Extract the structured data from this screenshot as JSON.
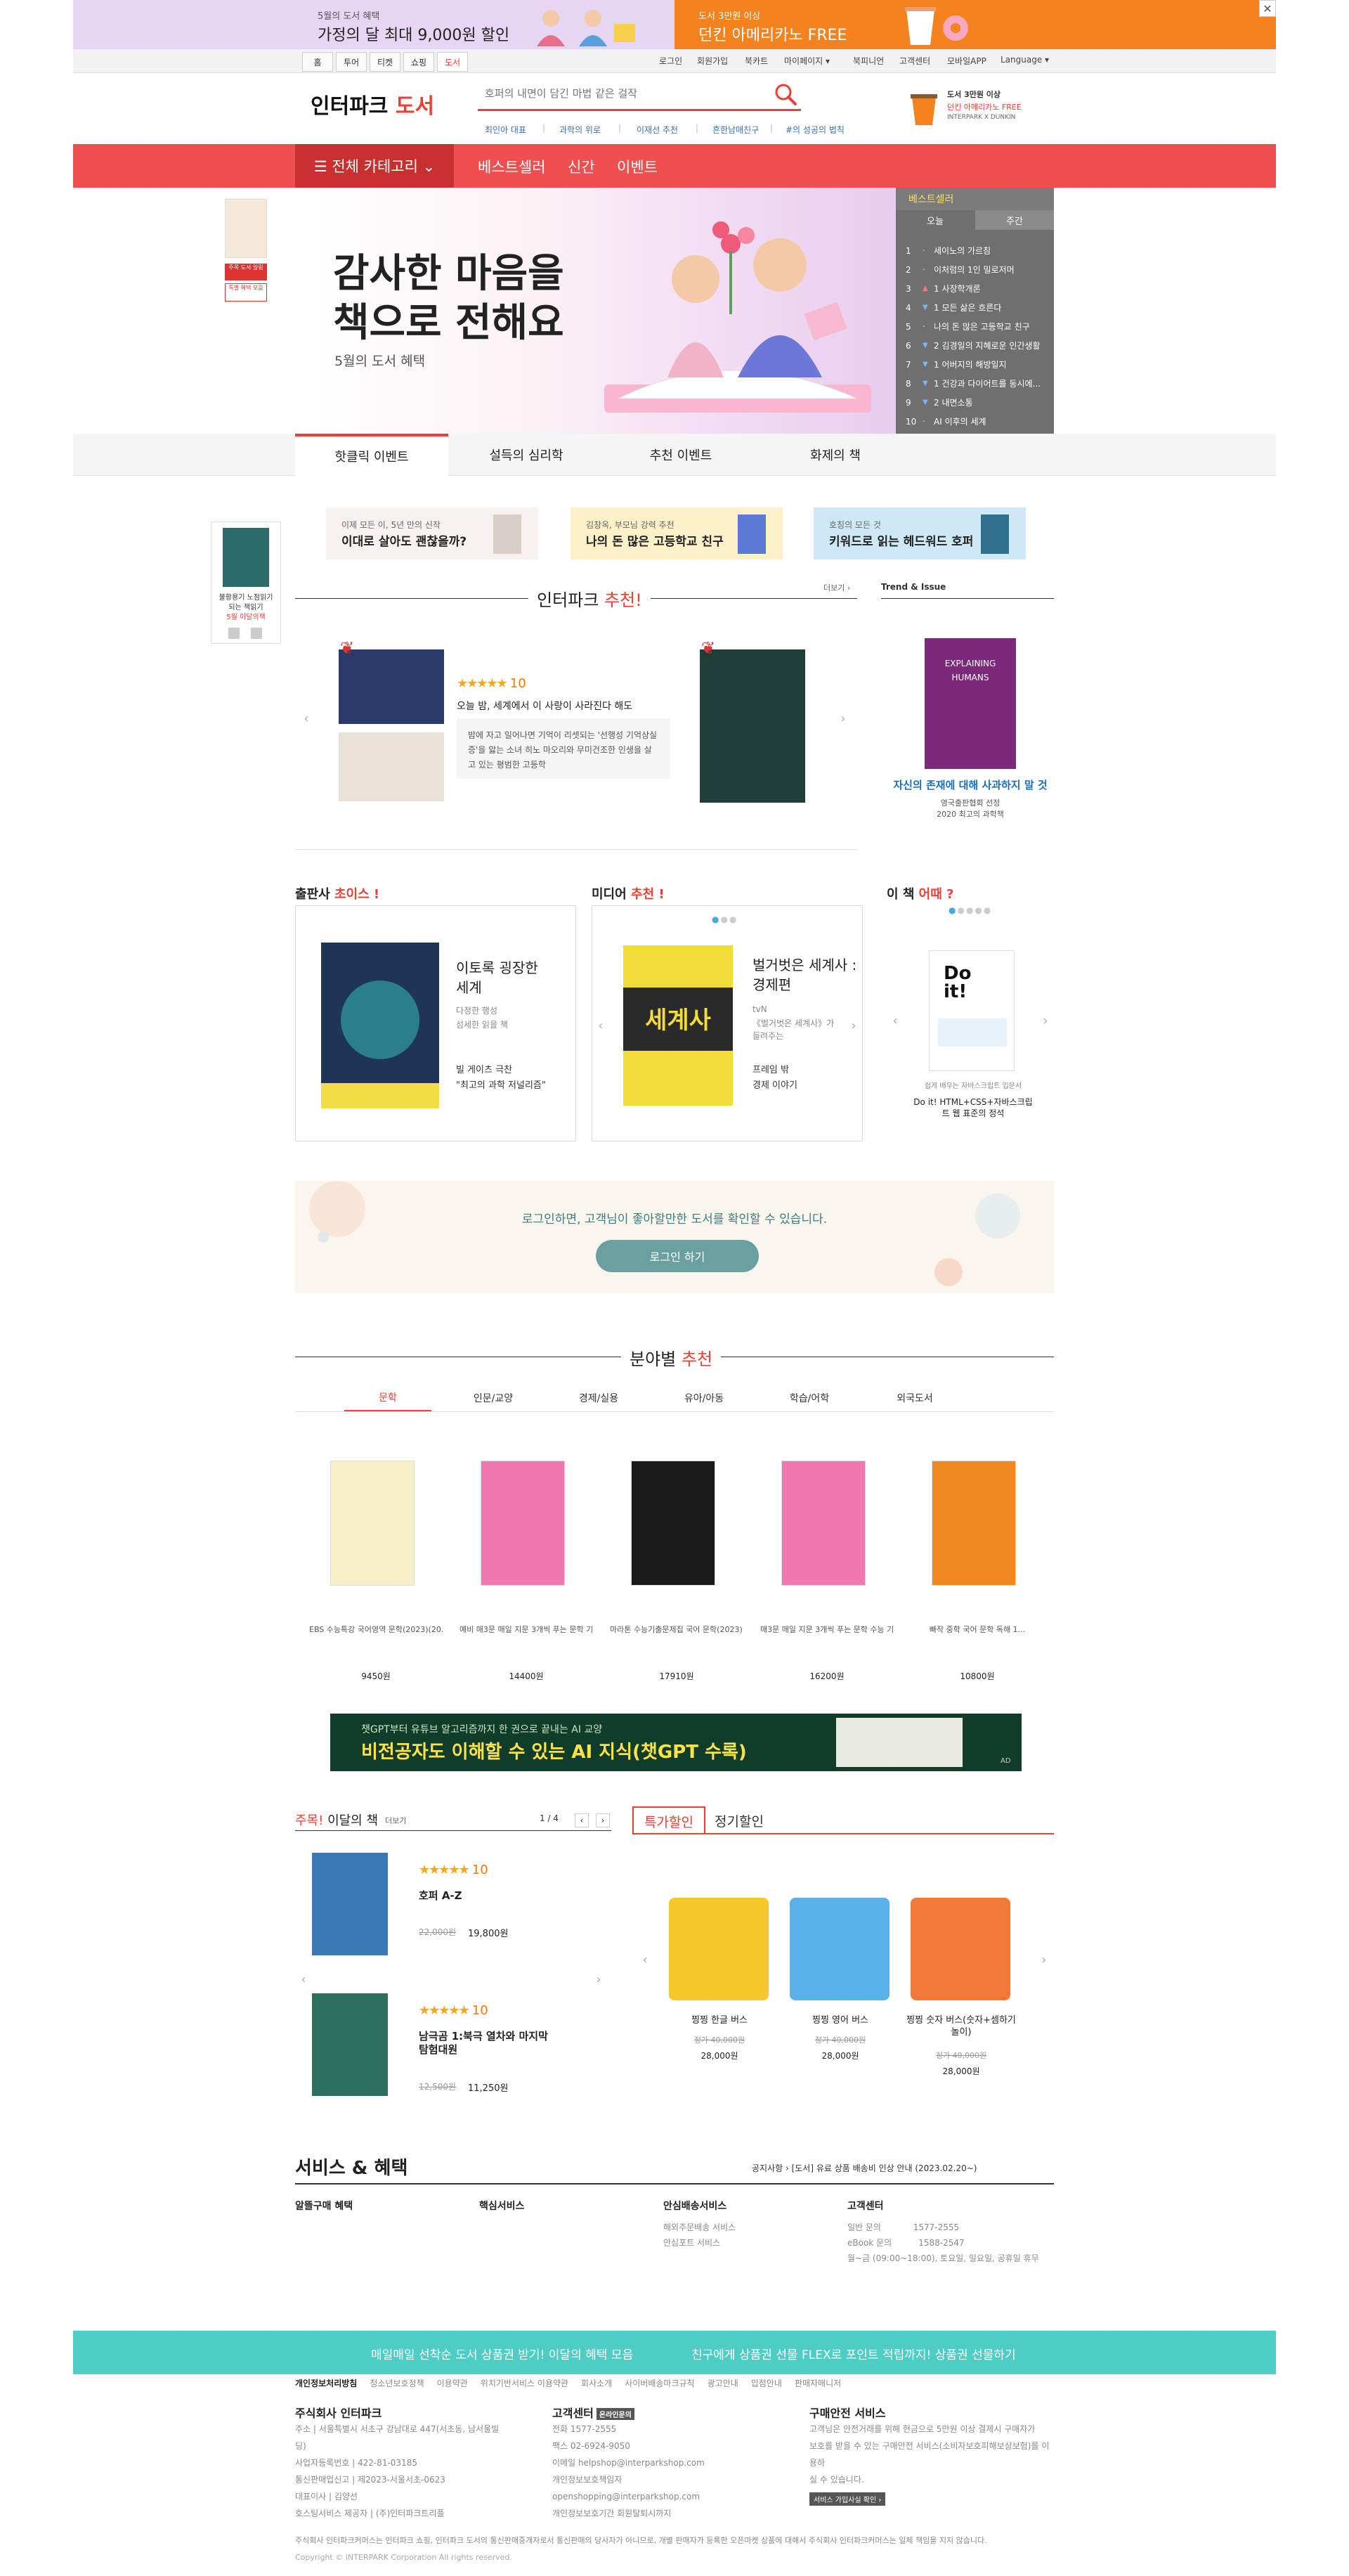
{
  "top_banner": {
    "left_small": "5월의 도서 혜택",
    "left_big": "가정의 달 최대 9,000원 할인",
    "right_small": "도서 3만원 이상",
    "right_big": "던킨 아메리카노 FREE",
    "close": "✕"
  },
  "gnb": {
    "tabs": [
      "홈",
      "투어",
      "티켓",
      "쇼핑",
      "도서"
    ],
    "active_tab": "도서",
    "util": [
      "로그인",
      "회원가입",
      "북카트",
      "마이페이지 ▾",
      "북피니언",
      "고객센터",
      "모바일APP",
      "Language ▾"
    ]
  },
  "header": {
    "logo_main": "인터파크",
    "logo_sub": "도서",
    "search_placeholder": "호퍼의 내면이 담긴 마법 같은 걸작",
    "keywords": [
      "최인아 대표",
      "과학의 위로",
      "이재선 추천",
      "흔한남매친구",
      "#의 성공의 법칙"
    ],
    "ad_line1": "도서 3만원 이상",
    "ad_line2": "던킨 아메리카노 FREE",
    "ad_line3": "INTERPARK X DUNKIN"
  },
  "nav": {
    "all_category": "☰ 전체 카테고리 ⌄",
    "links": [
      "베스트셀러",
      "신간",
      "이벤트"
    ]
  },
  "hero": {
    "title_line1": "감사한 마음을",
    "title_line2": "책으로 전해요",
    "subtitle": "5월의 도서 혜택"
  },
  "bestseller": {
    "title": "베스트셀러",
    "tabs": [
      "오늘",
      "주간"
    ],
    "items": [
      {
        "rank": "1",
        "change": "-",
        "title": "세이노의 가르침"
      },
      {
        "rank": "2",
        "change": "-",
        "title": "이처럼의 1인 밀로저머"
      },
      {
        "rank": "3",
        "change": "▲",
        "title": "1 사장학개론"
      },
      {
        "rank": "4",
        "change": "▼",
        "title": "1 모든 삶은 흐른다"
      },
      {
        "rank": "5",
        "change": "-",
        "title": "나의 돈 많은 고등학교 친구"
      },
      {
        "rank": "6",
        "change": "▼",
        "title": "2 김경일의 지혜로운 인간생활"
      },
      {
        "rank": "7",
        "change": "▼",
        "title": "1 어버지의 해방일지"
      },
      {
        "rank": "8",
        "change": "▼",
        "title": "1 건강과 다이어트를 동시에..."
      },
      {
        "rank": "9",
        "change": "▼",
        "title": "2 내면소통"
      },
      {
        "rank": "10",
        "change": "-",
        "title": "AI 이후의 세계"
      }
    ]
  },
  "left_mini": {
    "label1": "주목 도서 알림",
    "label2": "특별 혜택 모음"
  },
  "sub_tabs": [
    "핫클릭 이벤트",
    "설득의 심리학",
    "추천 이벤트",
    "화제의 책"
  ],
  "event_banners": [
    {
      "small": "이제 모든 이, 5년 만의 신작",
      "big": "이대로 살아도 괜찮을까?"
    },
    {
      "small": "김창옥, 부모님 강력 추천",
      "big": "나의 돈 많은 고등학교 친구"
    },
    {
      "small": "호칭의 모든 것",
      "big": "키워드로 읽는 헤드워드 호퍼"
    }
  ],
  "left_float": {
    "text1": "불황용기 노점읽기",
    "text2": "되는 책읽기",
    "text3": "5월 이달의책"
  },
  "interpark_pick": {
    "title_a": "인터파크 ",
    "title_b": "추천!",
    "more": "더보기 ›",
    "rating_stars": "★★★★★",
    "rating_score": "10",
    "book_title": "오늘 밤, 세계에서 이 사랑이 사라진다 해도",
    "book_desc": "밤에 자고 일어나면 기억이 리셋되는 '선행성 기억상실증'을 앓는 소녀 히노 마오리와 무미건조한 인생을 살고 있는 평범한 고등학"
  },
  "trend": {
    "title": "Trend & Issue",
    "caption1": "자신의 존재에 대해 사과하지 말 것",
    "caption2": "영국출판협회 선정",
    "caption3": "2020 최고의 과학책"
  },
  "publisher": {
    "label_a": "출판사 ",
    "label_b": "초이스 !",
    "book_title": "이토록 굉장한 세계",
    "book_sub": "다정한 행성",
    "book_sub2": "섬세한 읽을 책",
    "quote1": "빌 게이츠 극찬",
    "quote2": "\"최고의 과학 저널리즘\""
  },
  "media": {
    "label_a": "미디어 ",
    "label_b": "추천 !",
    "book_title": "벌거벗은 세계사 : 경제편",
    "line1": "tvN",
    "line2": "《벌거벗은 세계사》가",
    "line3": "들려주는",
    "line4": "프레임 밖",
    "line5": "경제 이야기"
  },
  "this_book": {
    "label_a": "이 책 ",
    "label_b": "어때 ?",
    "small": "쉽게 배우는 자바스크립트 입문서",
    "title": "Do it! HTML+CSS+자바스크립트 웹 표준의 정석"
  },
  "login_banner": {
    "text": "로그인하면, 고객님이 좋아할만한 도서를 확인할 수 있습니다.",
    "button": "로그인 하기"
  },
  "genre": {
    "title_a": "분야별 ",
    "title_b": "추천",
    "tabs": [
      "문학",
      "인문/교양",
      "경제/실용",
      "유아/아동",
      "학습/어학",
      "외국도서"
    ],
    "books": [
      {
        "title": "EBS 수능특강 국어영역 문학(2023)(20...",
        "price": "9450원"
      },
      {
        "title": "예비 매3문 매일 지문 3개씩 푸는 문학 기...",
        "price": "14400원"
      },
      {
        "title": "마라톤 수능기출문제집 국어 문학(2023)...",
        "price": "17910원"
      },
      {
        "title": "매3문 매일 지문 3개씩 푸는 문학 수능 기...",
        "price": "16200원"
      },
      {
        "title": "빠작 중학 국어 문학 독해 1...",
        "price": "10800원"
      }
    ]
  },
  "ai_banner": {
    "small": "챗GPT부터 유튜브 알고리즘까지 한 권으로 끝내는 AI 교양",
    "big": "비전공자도 이해할 수 있는 AI 지식(챗GPT 수록)",
    "tag": "AD"
  },
  "month_book": {
    "title_a": "주목! ",
    "title_b": "이달의 책",
    "more": "더보기",
    "page": "1 / 4",
    "items": [
      {
        "stars": "★★★★★",
        "score": "10",
        "title": "호퍼 A-Z",
        "old": "22,000원",
        "price": "19,800원"
      },
      {
        "stars": "★★★★★",
        "score": "10",
        "title": "남극곰 1:북극 열차와 마지막 탐험대원",
        "old": "12,500원",
        "price": "11,250원"
      }
    ]
  },
  "special": {
    "tabs": [
      "특가할인",
      "정기할인"
    ],
    "items": [
      {
        "title": "찡찡 한글 버스",
        "old": "정가 40,000원",
        "price": "28,000원"
      },
      {
        "title": "찡찡 영어 버스",
        "old": "정가 40,000원",
        "price": "28,000원"
      },
      {
        "title": "찡찡 숫자 버스(숫자+셈하기 놀이)",
        "old": "정가 40,000원",
        "price": "28,000원"
      }
    ]
  },
  "service": {
    "title": "서비스 & 혜택",
    "notice": "공지사항 › [도서] 유료 상품 배송비 인상 안내 (2023.02.20~)",
    "cols": [
      {
        "head": "알뜰구매 혜택",
        "lines": []
      },
      {
        "head": "핵심서비스",
        "lines": []
      },
      {
        "head": "안심배송서비스",
        "lines": [
          "해외주문배송 서비스",
          "안심포트 서비스"
        ]
      },
      {
        "head": "고객센터",
        "lines": [
          "일반 문의            1577-2555",
          "eBook 문의          1588-2547",
          "월~금 (09:00~18:00), 토요일, 일요일, 공휴일 휴무"
        ]
      }
    ]
  },
  "footer": {
    "bar_left": "매일매일 선착순 도서 상품권 받기! 이달의 혜택 모음",
    "bar_right": "친구에게 상품권 선물 FLEX로 포인트 적립까지! 상품권 선물하기",
    "links": [
      "개인정보처리방침",
      "청소년보호정책",
      "이용약관",
      "위치기반서비스 이용약관",
      "회사소개",
      "사이버배송마크규칙",
      "광고안내",
      "입점안내",
      "판매자매니저"
    ],
    "company_head": "주식회사 인터파크",
    "company_lines": [
      "주소 | 서울특별시 서초구 강남대로 447(서초동, 남서울빌딩)",
      "사업자등록번호 | 422-81-03185",
      "통신판매업신고 | 제2023-서울서초-0623",
      "대표이사 | 김양선",
      "호스팅서비스 제공자 | (주)인터파크트리플"
    ],
    "cs_head": "고객센터",
    "cs_badge": "온라인문의",
    "cs_lines": [
      "전화 1577-2555",
      "팩스 02-6924-9050",
      "이메일 helpshop@interparkshop.com",
      "개인정보보호책임자 openshopping@interparkshop.com",
      "개인정보보호기간 회원탈퇴시까지"
    ],
    "safe_head": "구매안전 서비스",
    "safe_lines": [
      "고객님은 안전거래를 위해 현금으로 5만원 이상 결제시 구매자가",
      "보호를 받을 수 있는 구매안전 서비스(소비자보호피해보상보험)를 이용하",
      "실 수 있습니다."
    ],
    "safe_badge": "서비스 가입사실 확인 ›",
    "disclaimer": "주식회사 인터파크커머스는 인터파크 쇼핑, 인터파크 도서의 통신판매중개자로서 통신판매의 당사자가 아니므로, 개별 판매자가 등록한 오픈마켓 상품에 대해서 주식회사 인터파크커머스는 일체 책임을 지지 않습니다.",
    "copyright": "Copyright © INTERPARK Corporation All rights reserved."
  }
}
